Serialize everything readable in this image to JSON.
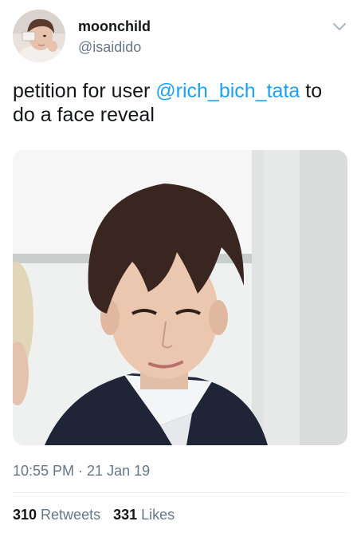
{
  "tweet": {
    "author": {
      "display_name": "moonchild",
      "handle": "@isaidido"
    },
    "text_before_mention": "petition for user ",
    "mention": "@rich_bich_tata",
    "text_after_mention": " to do a face reveal",
    "timestamp": "10:55 PM · 21 Jan 19",
    "stats": {
      "retweets_count": "310",
      "retweets_label": "Retweets",
      "likes_count": "331",
      "likes_label": "Likes"
    }
  },
  "icons": {
    "menu": "chevron-down-icon"
  },
  "colors": {
    "link": "#1da1f2",
    "secondary_text": "#657786",
    "primary_text": "#14171a"
  }
}
